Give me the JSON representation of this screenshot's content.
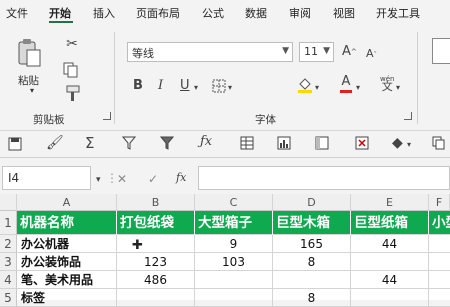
{
  "ribbon_tabs": [
    "文件",
    "开始",
    "插入",
    "页面布局",
    "公式",
    "数据",
    "审阅",
    "视图",
    "开发工具"
  ],
  "clipboard": {
    "paste_label": "粘贴",
    "group_label": "剪贴板"
  },
  "font": {
    "name": "等线",
    "size": "11",
    "group_label": "字体",
    "phonetic_glyph": "wén"
  },
  "namebox": {
    "value": "I4"
  },
  "formula_bar": {
    "fx": "fx",
    "cancel": "✕",
    "enter": "✓"
  },
  "columns": [
    "A",
    "B",
    "C",
    "D",
    "E",
    "F"
  ],
  "rows": [
    "1",
    "2",
    "3",
    "4",
    "5"
  ],
  "table": {
    "headers": [
      "机器名称",
      "打包纸袋",
      "大型箱子",
      "巨型木箱",
      "巨型纸箱",
      "小型"
    ],
    "data": [
      [
        "办公机器",
        "",
        "9",
        "165",
        "44",
        ""
      ],
      [
        "办公装饰品",
        "123",
        "103",
        "8",
        "",
        ""
      ],
      [
        "笔、美术用品",
        "486",
        "",
        "",
        "44",
        ""
      ],
      [
        "标签",
        "",
        "",
        "8",
        "",
        ""
      ]
    ]
  },
  "colors": {
    "header_green": "#0fa94f",
    "accent": "#217346",
    "font_red": "#e02020",
    "fill_yellow": "#ffd800"
  }
}
